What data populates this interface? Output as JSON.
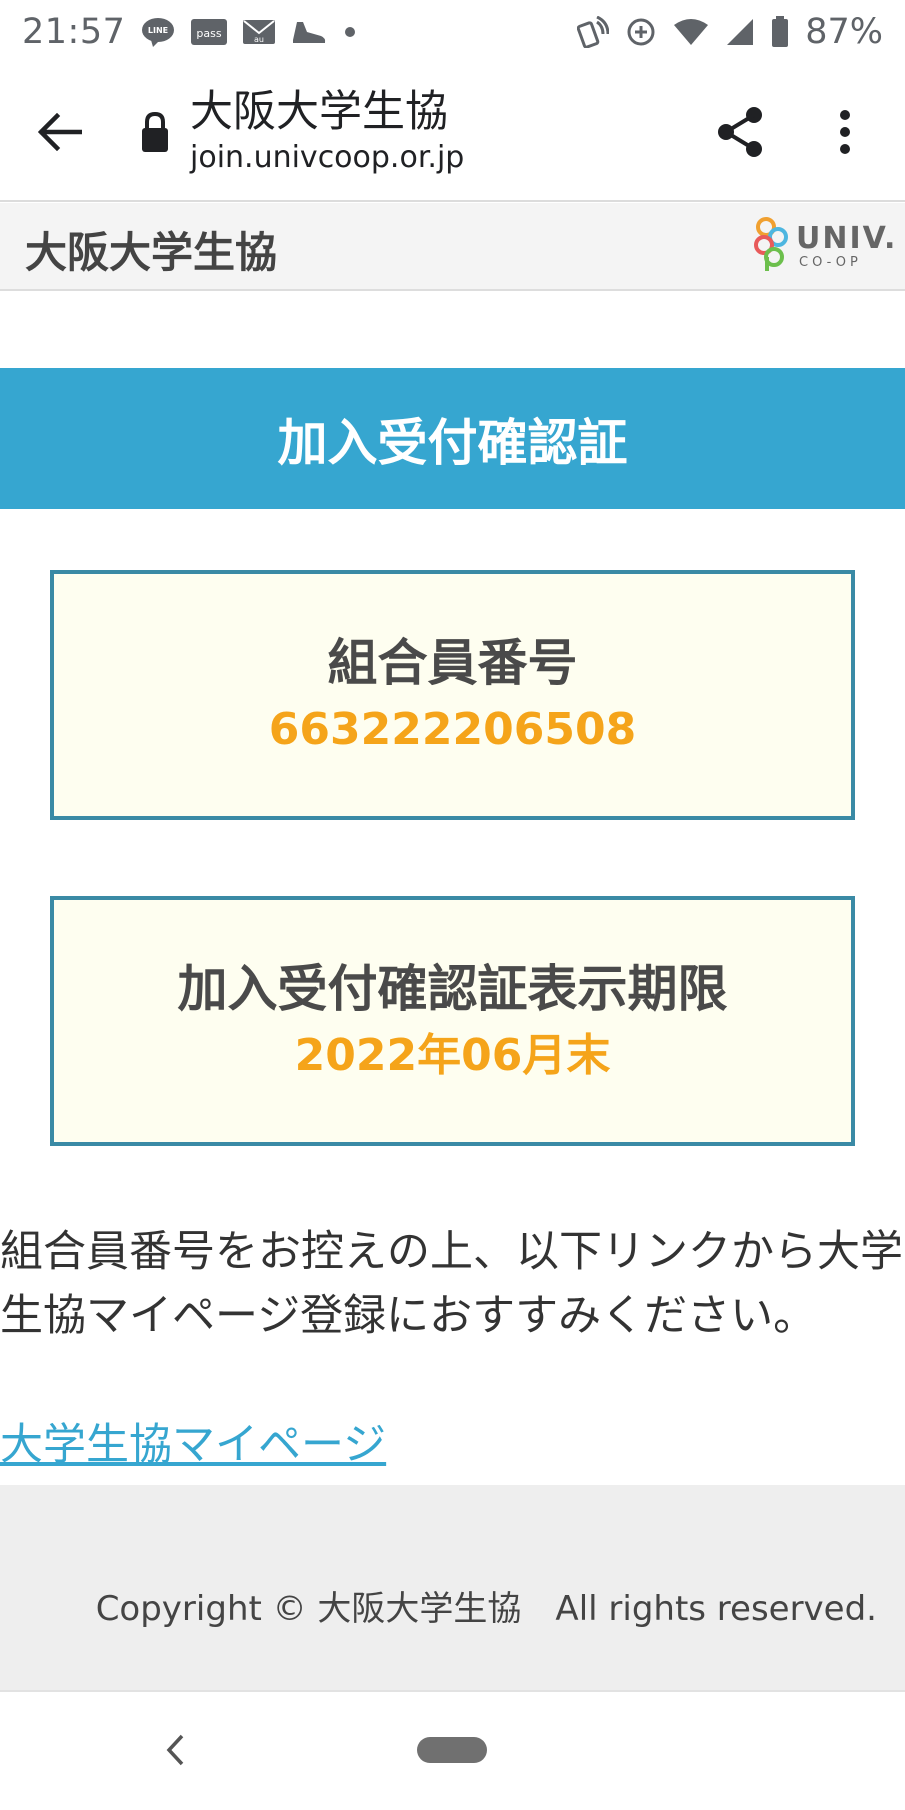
{
  "status_bar": {
    "time": "21:57",
    "battery": "87%",
    "left_icons": [
      "line-icon",
      "pass-icon",
      "au-mail-icon",
      "shoe-icon",
      "dot-icon"
    ],
    "right_icons": [
      "nfc-icon",
      "data-saver-icon",
      "wifi-icon",
      "signal-icon",
      "battery-icon"
    ]
  },
  "browser": {
    "title": "大阪大学生協",
    "domain": "join.univcoop.or.jp"
  },
  "site_header": {
    "title": "大阪大学生協",
    "logo_text": "UNIV.",
    "logo_subtext": "CO-OP"
  },
  "banner": {
    "title": "加入受付確認証"
  },
  "member_box": {
    "label": "組合員番号",
    "value": "663222206508"
  },
  "expiry_box": {
    "label": "加入受付確認証表示期限",
    "value": "2022年06月末"
  },
  "body": {
    "message": "組合員番号をお控えの上、以下リンクから大学生協マイページ登録におすすみください。",
    "link_label": "大学生協マイページ"
  },
  "footer": {
    "copyright": "Copyright © 大阪大学生協　All rights reserved."
  },
  "colors": {
    "banner": "#36a6d0",
    "box_border": "#3a8aa5",
    "box_bg": "#fefef0",
    "accent_value": "#f5a41a",
    "link": "#36a6d0"
  }
}
